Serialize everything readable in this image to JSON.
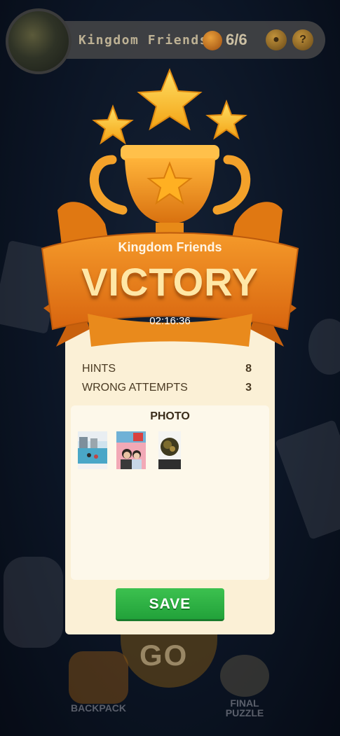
{
  "header": {
    "title": "Kingdom Friends",
    "progress": "6/6",
    "icons": [
      "backpack-icon",
      "coin-button",
      "hint-button"
    ]
  },
  "victory": {
    "subtitle": "Kingdom Friends",
    "title": "VICTORY",
    "time": "02:16:36",
    "stars": 3
  },
  "stats": [
    {
      "label": "HINTS",
      "value": "8"
    },
    {
      "label": "WRONG ATTEMPTS",
      "value": "3"
    }
  ],
  "photo": {
    "title": "PHOTO",
    "count": 3
  },
  "save_label": "SAVE",
  "nav": {
    "go_label": "GO",
    "backpack_label": "BACKPACK",
    "final_puzzle_label": "FINAL PUZZLE"
  },
  "colors": {
    "card_bg": "#fbf0d6",
    "save_green": "#2fb544",
    "banner_orange": "#e8801c",
    "gold": "#ffc52e"
  }
}
